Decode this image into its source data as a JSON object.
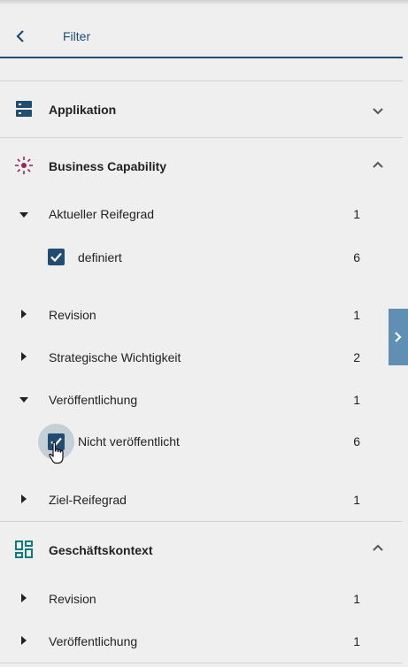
{
  "header": {
    "title": "Filter"
  },
  "sections": {
    "applikation": {
      "label": "Applikation",
      "icon": "server-icon",
      "expanded": false
    },
    "business_capability": {
      "label": "Business Capability",
      "icon": "capability-icon",
      "expanded": true,
      "groups": [
        {
          "label": "Aktueller Reifegrad",
          "count": "1",
          "expanded": true,
          "options": [
            {
              "label": "definiert",
              "count": "6",
              "checked": true
            }
          ]
        },
        {
          "label": "Revision",
          "count": "1",
          "expanded": false
        },
        {
          "label": "Strategische Wichtigkeit",
          "count": "2",
          "expanded": false
        },
        {
          "label": "Veröffentlichung",
          "count": "1",
          "expanded": true,
          "options": [
            {
              "label": "Nicht veröffentlicht",
              "count": "6",
              "checked": true
            }
          ]
        },
        {
          "label": "Ziel-Reifegrad",
          "count": "1",
          "expanded": false
        }
      ]
    },
    "geschaeftskontext": {
      "label": "Geschäftskontext",
      "icon": "dashboard-icon",
      "expanded": true,
      "groups": [
        {
          "label": "Revision",
          "count": "1",
          "expanded": false
        },
        {
          "label": "Veröffentlichung",
          "count": "1",
          "expanded": false
        }
      ]
    }
  },
  "colors": {
    "primary": "#1f4e72",
    "capability_accent": "#8e2a54",
    "context_accent": "#0b7d7d",
    "side_tab": "#5f8fb3"
  }
}
